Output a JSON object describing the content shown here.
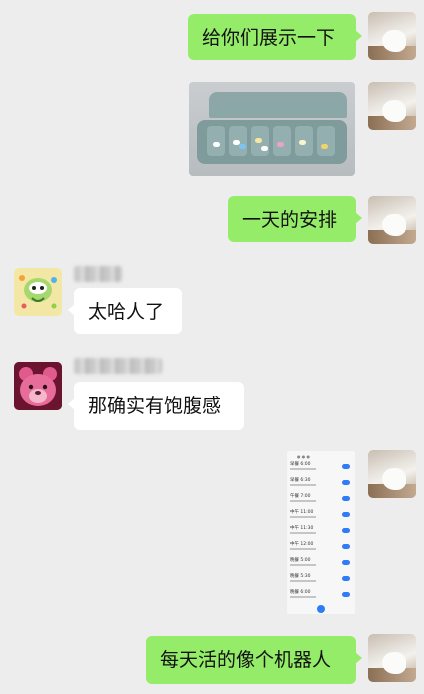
{
  "messages": [
    {
      "id": "m1",
      "side": "right",
      "type": "text",
      "text": "给你们展示一下"
    },
    {
      "id": "m2",
      "side": "right",
      "type": "image",
      "alt": "pill-organizer-photo"
    },
    {
      "id": "m3",
      "side": "right",
      "type": "text",
      "text": "一天的安排"
    },
    {
      "id": "m4",
      "side": "left",
      "type": "text",
      "text": "太哈人了"
    },
    {
      "id": "m5",
      "side": "left",
      "type": "text",
      "text": "那确实有饱腹感"
    },
    {
      "id": "m6",
      "side": "right",
      "type": "image",
      "alt": "alarm-list-screenshot"
    },
    {
      "id": "m7",
      "side": "right",
      "type": "text",
      "text": "每天活的像个机器人"
    }
  ],
  "alarm_screenshot": {
    "alarms": [
      {
        "time": "早餐 6:00"
      },
      {
        "time": "早餐 6:30"
      },
      {
        "time": "午餐 7:00"
      },
      {
        "time": "中午 11:00"
      },
      {
        "time": "中午 11:30"
      },
      {
        "time": "中午 12:00"
      },
      {
        "time": "晚餐 5:00"
      },
      {
        "time": "晚餐 5:30"
      },
      {
        "time": "晚餐 6:00"
      }
    ]
  },
  "colors": {
    "background": "#ededed",
    "my_bubble": "#95ec69",
    "their_bubble": "#ffffff",
    "toggle_on": "#2e7cf6"
  }
}
